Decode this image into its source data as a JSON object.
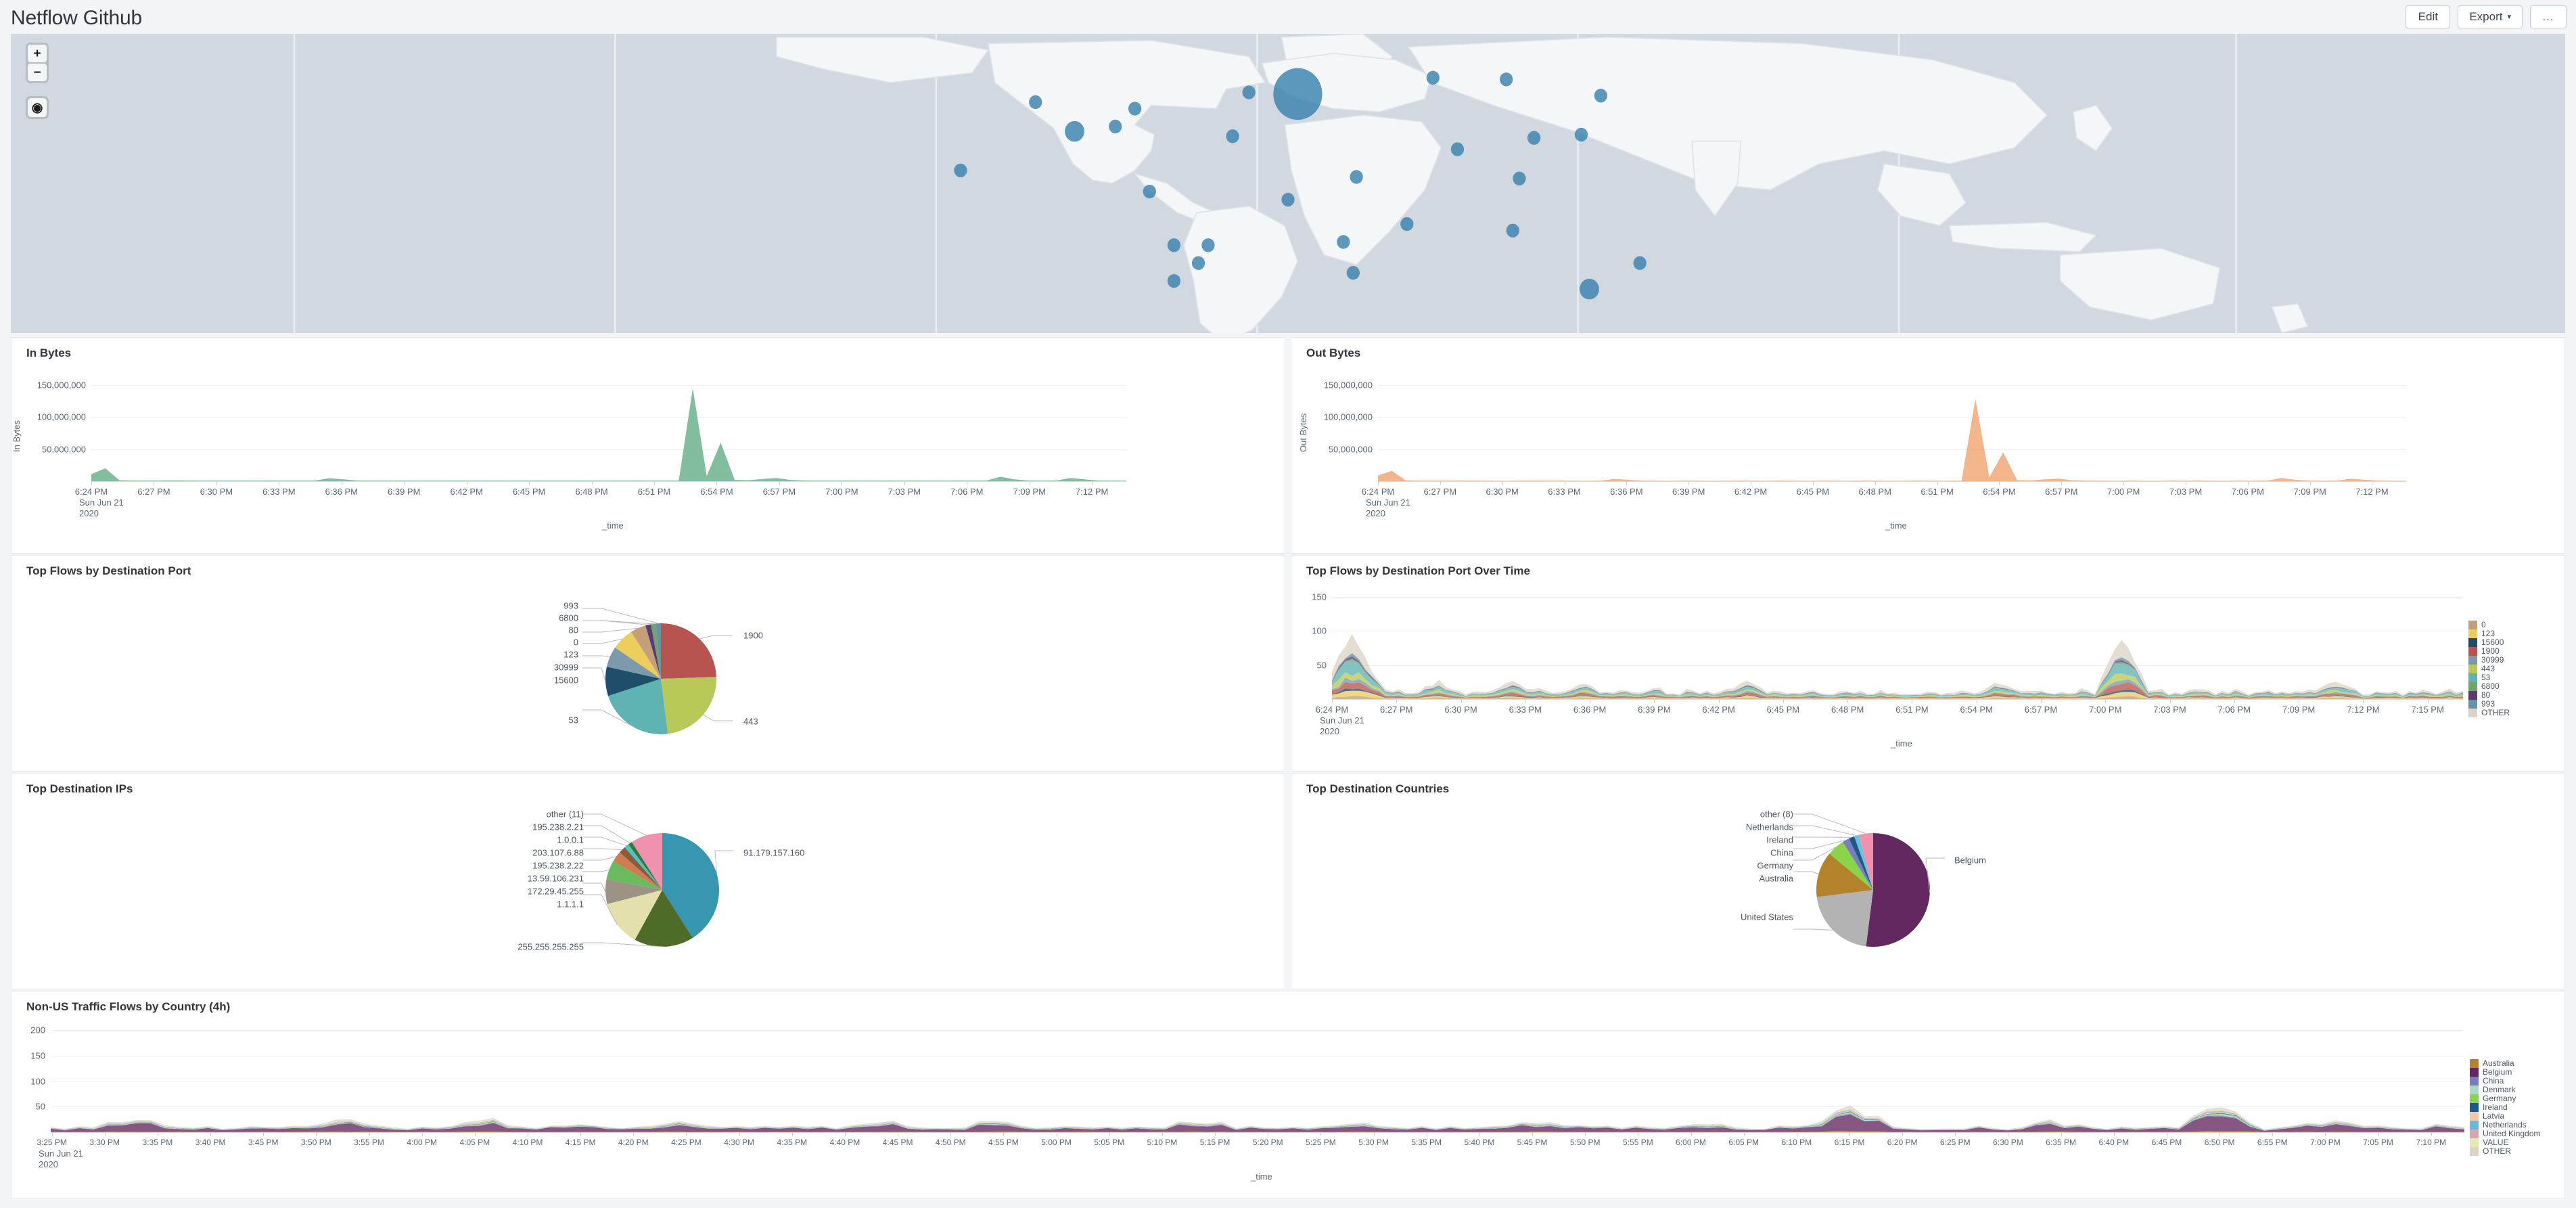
{
  "header": {
    "title": "Netflow Github",
    "buttons": [
      {
        "label": "Edit",
        "name": "edit-button"
      },
      {
        "label": "Export",
        "name": "export-button",
        "caret": "▾"
      },
      {
        "label": "...",
        "name": "more-options-button"
      }
    ]
  },
  "map": {
    "name": "world-map-panel",
    "controls": {
      "zoom_in": "+",
      "zoom_out": "−",
      "locate": "◉"
    },
    "ocean_color": "#d2d8e0",
    "land_color": "#f4f6f8",
    "bubble_color": "#3a82ad",
    "bubbles": [
      {
        "x": 790,
        "y": 37,
        "r": 15,
        "label": "Belgium"
      },
      {
        "x": 760,
        "y": 36,
        "r": 4
      },
      {
        "x": 873,
        "y": 27,
        "r": 4
      },
      {
        "x": 918,
        "y": 28,
        "r": 4
      },
      {
        "x": 976,
        "y": 38,
        "r": 4
      },
      {
        "x": 935,
        "y": 64,
        "r": 4
      },
      {
        "x": 964,
        "y": 62,
        "r": 4
      },
      {
        "x": 888,
        "y": 71,
        "r": 4
      },
      {
        "x": 926,
        "y": 89,
        "r": 4
      },
      {
        "x": 750,
        "y": 63,
        "r": 4
      },
      {
        "x": 784,
        "y": 102,
        "r": 4
      },
      {
        "x": 826,
        "y": 88,
        "r": 4
      },
      {
        "x": 818,
        "y": 128,
        "r": 4
      },
      {
        "x": 824,
        "y": 147,
        "r": 4
      },
      {
        "x": 857,
        "y": 117,
        "r": 4
      },
      {
        "x": 922,
        "y": 121,
        "r": 4
      },
      {
        "x": 1000,
        "y": 141,
        "r": 4
      },
      {
        "x": 969,
        "y": 157,
        "r": 6
      },
      {
        "x": 629,
        "y": 42,
        "r": 4
      },
      {
        "x": 678,
        "y": 57,
        "r": 4
      },
      {
        "x": 653,
        "y": 60,
        "r": 6
      },
      {
        "x": 690,
        "y": 46,
        "r": 4
      },
      {
        "x": 583,
        "y": 84,
        "r": 4
      },
      {
        "x": 699,
        "y": 97,
        "r": 4
      },
      {
        "x": 714,
        "y": 130,
        "r": 4
      },
      {
        "x": 735,
        "y": 130,
        "r": 4
      },
      {
        "x": 729,
        "y": 141,
        "r": 4
      },
      {
        "x": 714,
        "y": 152,
        "r": 4
      },
      {
        "x": 699,
        "y": 195,
        "r": 4
      }
    ]
  },
  "panels": {
    "in_bytes": {
      "title": "In Bytes",
      "name": "in-bytes-panel"
    },
    "out_bytes": {
      "title": "Out Bytes",
      "name": "out-bytes-panel"
    },
    "top_flows_port": {
      "title": "Top Flows by Destination Port",
      "name": "top-flows-by-destination-port-panel"
    },
    "top_flows_port_time": {
      "title": "Top Flows by Destination Port Over Time",
      "name": "top-flows-by-destination-port-over-time-panel"
    },
    "top_dest_ips": {
      "title": "Top Destination IPs",
      "name": "top-destination-ips-panel"
    },
    "top_dest_countries": {
      "title": "Top Destination Countries",
      "name": "top-destination-countries-panel"
    },
    "non_us_flows": {
      "title": "Non-US Traffic Flows by Country (4h)",
      "name": "non-us-traffic-flows-by-country-panel"
    }
  },
  "chart_data": [
    {
      "id": "in_bytes",
      "type": "area",
      "title": "In Bytes",
      "xlabel": "_time",
      "ylabel": "In Bytes",
      "ylim": [
        0,
        175000000
      ],
      "yticks": [
        50000000,
        100000000,
        150000000
      ],
      "ytick_labels": [
        "50,000,000",
        "100,000,000",
        "150,000,000"
      ],
      "grid": true,
      "legend": [
        {
          "name": "In Bytes",
          "color": "#6cb28e"
        }
      ],
      "xticks": [
        "6:24 PM",
        "6:27 PM",
        "6:30 PM",
        "6:33 PM",
        "6:36 PM",
        "6:39 PM",
        "6:42 PM",
        "6:45 PM",
        "6:48 PM",
        "6:51 PM",
        "6:54 PM",
        "6:57 PM",
        "7:00 PM",
        "7:03 PM",
        "7:06 PM",
        "7:09 PM",
        "7:12 PM"
      ],
      "xtick_sub": [
        "Sun Jun 21",
        "2020"
      ],
      "series": [
        {
          "name": "In Bytes",
          "color": "#6cb28e",
          "values": [
            11000000,
            20000000,
            1500000,
            900000,
            900000,
            1000000,
            1100000,
            900000,
            800000,
            700000,
            800000,
            900000,
            1000000,
            900000,
            800000,
            700000,
            900000,
            4500000,
            3000000,
            900000,
            800000,
            700000,
            900000,
            800000,
            700000,
            800000,
            900000,
            800000,
            700000,
            900000,
            800000,
            700000,
            900000,
            800000,
            700000,
            900000,
            800000,
            700000,
            800000,
            900000,
            800000,
            700000,
            900000,
            145000000,
            8000000,
            60000000,
            2000000,
            1500000,
            3500000,
            4800000,
            1800000,
            900000,
            800000,
            700000,
            900000,
            800000,
            700000,
            900000,
            800000,
            900000,
            800000,
            700000,
            900000,
            800000,
            900000,
            7000000,
            3000000,
            900000,
            800000,
            900000,
            5000000,
            3000000,
            900000,
            800000,
            700000
          ]
        }
      ]
    },
    {
      "id": "out_bytes",
      "type": "area",
      "title": "Out Bytes",
      "xlabel": "_time",
      "ylabel": "Out Bytes",
      "ylim": [
        0,
        175000000
      ],
      "yticks": [
        50000000,
        100000000,
        150000000
      ],
      "ytick_labels": [
        "50,000,000",
        "100,000,000",
        "150,000,000"
      ],
      "grid": true,
      "legend": [
        {
          "name": "Out Bytes",
          "color": "#f0945d"
        }
      ],
      "xticks": [
        "6:24 PM",
        "6:27 PM",
        "6:30 PM",
        "6:33 PM",
        "6:36 PM",
        "6:39 PM",
        "6:42 PM",
        "6:45 PM",
        "6:48 PM",
        "6:51 PM",
        "6:54 PM",
        "6:57 PM",
        "7:00 PM",
        "7:03 PM",
        "7:06 PM",
        "7:09 PM",
        "7:12 PM"
      ],
      "xtick_sub": [
        "Sun Jun 21",
        "2020"
      ],
      "series": [
        {
          "name": "Out Bytes",
          "color": "#f0a878",
          "values": [
            9000000,
            16000000,
            1200000,
            700000,
            700000,
            800000,
            900000,
            700000,
            600000,
            500000,
            600000,
            700000,
            800000,
            700000,
            600000,
            500000,
            700000,
            3500000,
            2200000,
            700000,
            600000,
            500000,
            700000,
            600000,
            500000,
            600000,
            700000,
            600000,
            500000,
            700000,
            600000,
            500000,
            700000,
            600000,
            500000,
            700000,
            600000,
            500000,
            600000,
            700000,
            600000,
            500000,
            700000,
            128000000,
            6000000,
            45000000,
            1600000,
            1200000,
            2800000,
            3800000,
            1400000,
            700000,
            600000,
            500000,
            700000,
            600000,
            500000,
            700000,
            600000,
            700000,
            600000,
            500000,
            700000,
            600000,
            700000,
            5000000,
            2200000,
            700000,
            600000,
            700000,
            3800000,
            2200000,
            700000,
            600000,
            500000
          ]
        }
      ]
    },
    {
      "id": "top_flows_port",
      "type": "pie",
      "title": "Top Flows by Destination Port",
      "labels": [
        "1900",
        "443",
        "53",
        "15600",
        "30999",
        "123",
        "0",
        "80",
        "6800",
        "993"
      ],
      "values": [
        24.5,
        23.5,
        22.0,
        8.5,
        6.0,
        6.5,
        4.5,
        1.6,
        1.4,
        1.5
      ],
      "colors": [
        "#b85450",
        "#b8c95a",
        "#5fb3b3",
        "#1f4e6b",
        "#7b9aab",
        "#edcd5c",
        "#c4a07a",
        "#5b3a73",
        "#6fa56f",
        "#6b8fa3"
      ],
      "label_side": [
        "right",
        "right",
        "left",
        "left",
        "left",
        "left",
        "left",
        "left",
        "left",
        "left"
      ]
    },
    {
      "id": "top_flows_port_time",
      "type": "area",
      "stacked": true,
      "title": "Top Flows by Destination Port Over Time",
      "xlabel": "_time",
      "ylim": [
        0,
        165
      ],
      "yticks": [
        50,
        100,
        150
      ],
      "ytick_labels": [
        "50",
        "100",
        "150"
      ],
      "grid": true,
      "xticks": [
        "6:24 PM",
        "6:27 PM",
        "6:30 PM",
        "6:33 PM",
        "6:36 PM",
        "6:39 PM",
        "6:42 PM",
        "6:45 PM",
        "6:48 PM",
        "6:51 PM",
        "6:54 PM",
        "6:57 PM",
        "7:00 PM",
        "7:03 PM",
        "7:06 PM",
        "7:09 PM",
        "7:12 PM",
        "7:15 PM"
      ],
      "xtick_sub": [
        "Sun Jun 21",
        "2020"
      ],
      "legend_position": "right",
      "legend": [
        {
          "name": "0",
          "color": "#c4a07a"
        },
        {
          "name": "123",
          "color": "#edcd5c"
        },
        {
          "name": "15600",
          "color": "#1f4e6b"
        },
        {
          "name": "1900",
          "color": "#b85450"
        },
        {
          "name": "30999",
          "color": "#7b9aab"
        },
        {
          "name": "443",
          "color": "#b8c95a"
        },
        {
          "name": "53",
          "color": "#5fb3b3"
        },
        {
          "name": "6800",
          "color": "#6fa56f"
        },
        {
          "name": "80",
          "color": "#5b3a73"
        },
        {
          "name": "993",
          "color": "#6b8fa3"
        },
        {
          "name": "OTHER",
          "color": "#ddd3c4"
        }
      ]
    },
    {
      "id": "top_dest_ips",
      "type": "pie",
      "title": "Top Destination IPs",
      "labels": [
        "91.179.157.160",
        "255.255.255.255",
        "1.1.1.1",
        "172.29.45.255",
        "13.59.106.231",
        "195.238.2.22",
        "203.107.6.88",
        "1.0.0.1",
        "195.238.2.21",
        "other (11)"
      ],
      "values": [
        41.0,
        17.0,
        13.0,
        7.0,
        5.5,
        3.0,
        2.0,
        1.3,
        1.2,
        9.0
      ],
      "colors": [
        "#3796b0",
        "#4f6b28",
        "#e4e0ad",
        "#9b9383",
        "#6aba5e",
        "#d07b52",
        "#8a5a3b",
        "#4fc4c4",
        "#2f7a3f",
        "#f091ad"
      ],
      "label_side": [
        "right",
        "left",
        "left",
        "left",
        "left",
        "left",
        "left",
        "left",
        "left",
        "left"
      ]
    },
    {
      "id": "top_dest_countries",
      "type": "pie",
      "title": "Top Destination Countries",
      "labels": [
        "Belgium",
        "United States",
        "Australia",
        "Germany",
        "China",
        "Ireland",
        "Netherlands",
        "other (8)"
      ],
      "values": [
        52.0,
        21.0,
        13.0,
        5.0,
        2.0,
        1.6,
        1.4,
        4.0
      ],
      "colors": [
        "#63285f",
        "#b3b3b3",
        "#b3822a",
        "#8ad44a",
        "#7b7bbf",
        "#1a5a8a",
        "#6fc0d8",
        "#f091ad"
      ],
      "label_side": [
        "right",
        "left",
        "left",
        "left",
        "left",
        "left",
        "left",
        "left"
      ]
    },
    {
      "id": "non_us_flows",
      "type": "area",
      "stacked": true,
      "title": "Non-US Traffic Flows by Country (4h)",
      "xlabel": "_time",
      "ylim": [
        0,
        215
      ],
      "yticks": [
        50,
        100,
        150,
        200
      ],
      "ytick_labels": [
        "50",
        "100",
        "150",
        "200"
      ],
      "grid": true,
      "xticks": [
        "3:25 PM",
        "3:30 PM",
        "3:35 PM",
        "3:40 PM",
        "3:45 PM",
        "3:50 PM",
        "3:55 PM",
        "4:00 PM",
        "4:05 PM",
        "4:10 PM",
        "4:15 PM",
        "4:20 PM",
        "4:25 PM",
        "4:30 PM",
        "4:35 PM",
        "4:40 PM",
        "4:45 PM",
        "4:50 PM",
        "4:55 PM",
        "5:00 PM",
        "5:05 PM",
        "5:10 PM",
        "5:15 PM",
        "5:20 PM",
        "5:25 PM",
        "5:30 PM",
        "5:35 PM",
        "5:40 PM",
        "5:45 PM",
        "5:50 PM",
        "5:55 PM",
        "6:00 PM",
        "6:05 PM",
        "6:10 PM",
        "6:15 PM",
        "6:20 PM",
        "6:25 PM",
        "6:30 PM",
        "6:35 PM",
        "6:40 PM",
        "6:45 PM",
        "6:50 PM",
        "6:55 PM",
        "7:00 PM",
        "7:05 PM",
        "7:10 PM"
      ],
      "xtick_sub": [
        "Sun Jun 21",
        "2020"
      ],
      "legend_position": "right",
      "legend": [
        {
          "name": "Australia",
          "color": "#b3822a"
        },
        {
          "name": "Belgium",
          "color": "#63285f"
        },
        {
          "name": "China",
          "color": "#7b7bbf"
        },
        {
          "name": "Denmark",
          "color": "#a8d8c8"
        },
        {
          "name": "Germany",
          "color": "#8ad44a"
        },
        {
          "name": "Ireland",
          "color": "#1a5a8a"
        },
        {
          "name": "Latvia",
          "color": "#f6c7a3"
        },
        {
          "name": "Netherlands",
          "color": "#6fb6d8"
        },
        {
          "name": "United Kingdom",
          "color": "#d9a3b0"
        },
        {
          "name": "VALUE",
          "color": "#e2eab0"
        },
        {
          "name": "OTHER",
          "color": "#ddd3c4"
        }
      ]
    }
  ]
}
